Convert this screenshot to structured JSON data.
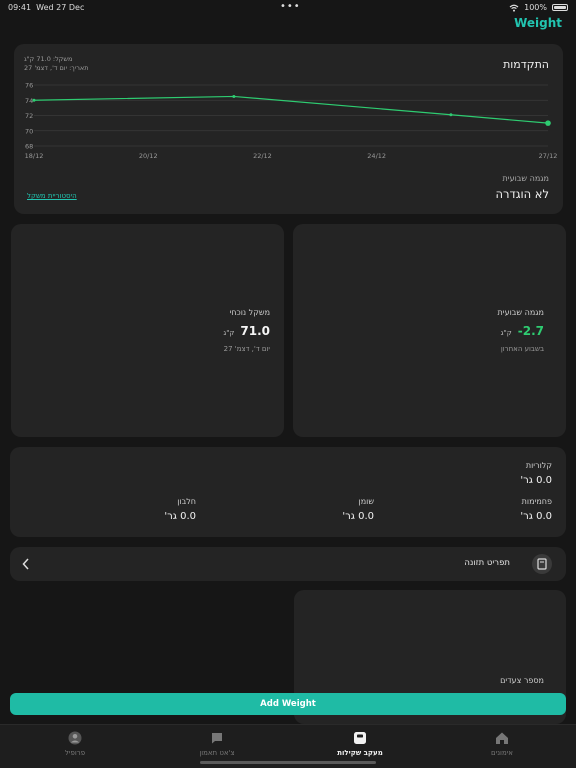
{
  "status": {
    "time": "09:41",
    "date": "Wed 27 Dec",
    "battery": "100%"
  },
  "app": {
    "title": "Weight"
  },
  "progress": {
    "title": "התקדמות",
    "info_line1": "משקל: 71.0 ק\"ג",
    "info_line2": "תאריך: יום ד', דצמ' 27",
    "trend_label": "מגמה שבועית",
    "trend_value": "לא הוגדרה",
    "history_link": "היסטוריית משקל"
  },
  "chart_data": {
    "type": "line",
    "x": [
      "18/12",
      "21/12",
      "25/12",
      "27/12"
    ],
    "xtick_labels": [
      "18/12",
      "20/12",
      "22/12",
      "24/12",
      "27/12"
    ],
    "xtick_days": [
      18,
      20,
      22,
      24,
      27
    ],
    "x_days": [
      18,
      21.5,
      25.3,
      27
    ],
    "series": [
      {
        "values": [
          74.0,
          74.5,
          72.1,
          71.0
        ]
      }
    ],
    "yticks": [
      68,
      70,
      72,
      74,
      76
    ],
    "ylim": [
      68,
      76
    ],
    "xlim_days": [
      18,
      27
    ],
    "grid": true,
    "color": "#2ecc71"
  },
  "trend_card": {
    "label": "מגמה שבועית",
    "value": "-2.7",
    "unit": "ק\"ג",
    "sub": "בשבוע האחרון"
  },
  "current_card": {
    "label": "משקל נוכחי",
    "value": "71.0",
    "unit": "ק\"ג",
    "sub": "יום ד', דצמ' 27"
  },
  "nutrition": {
    "calories_label": "קלוריות",
    "calories_value": "0.0 גר'",
    "carbs_label": "פחמימות",
    "carbs_value": "0.0 גר'",
    "fat_label": "שומן",
    "fat_value": "0.0 גר'",
    "protein_label": "חלבון",
    "protein_value": "0.0 גר'"
  },
  "menu_row": {
    "label": "תפריט תזונה"
  },
  "steps_card": {
    "label": "מספר צעדים"
  },
  "add_button": {
    "label": "Add Weight"
  },
  "tabs": [
    {
      "label": "אימונים"
    },
    {
      "label": "מעקב שקילות"
    },
    {
      "label": "צ'אט תאמון"
    },
    {
      "label": "פרופיל"
    }
  ]
}
